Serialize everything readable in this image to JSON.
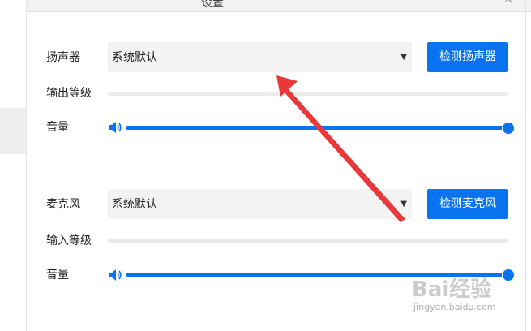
{
  "window": {
    "title": "设置"
  },
  "speaker": {
    "label": "扬声器",
    "device": "系统默认",
    "test_button": "检测扬声器",
    "level_label": "输出等级",
    "volume_label": "音量",
    "volume": 1.0
  },
  "microphone": {
    "label": "麦克风",
    "device": "系统默认",
    "test_button": "检测麦克风",
    "level_label": "输入等级",
    "volume_label": "音量",
    "volume": 1.0
  },
  "icons": {
    "dropdown": "caret-down-icon",
    "volume": "speaker-volume-icon",
    "close": "close-icon"
  },
  "colors": {
    "accent": "#0a74f0",
    "annotation_arrow": "#e8383a",
    "select_bg": "#f3f3f3"
  },
  "watermark": {
    "brand": "Bai经验",
    "url": "jingyan.baidu.com"
  }
}
